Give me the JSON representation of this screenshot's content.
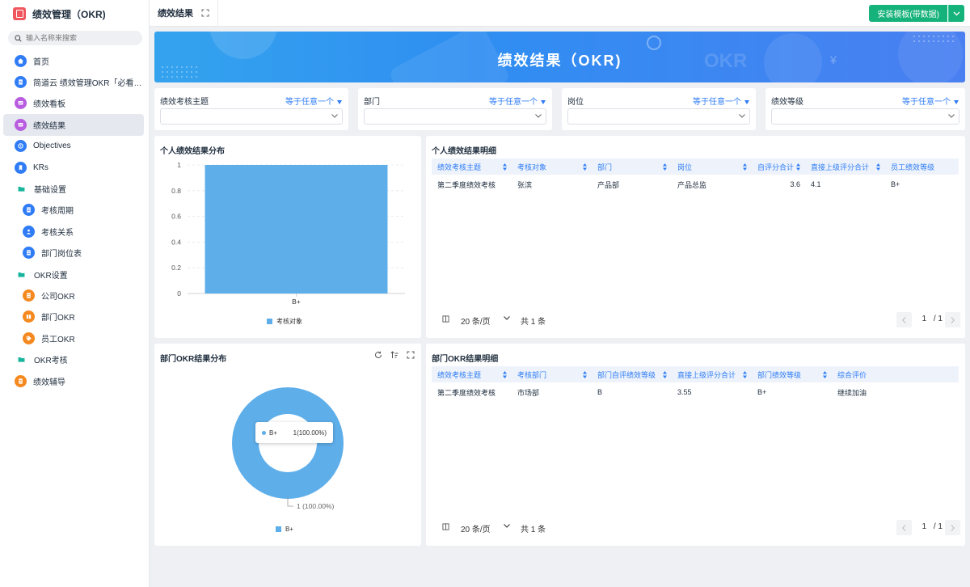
{
  "app": {
    "title": "绩效管理（OKR)"
  },
  "search": {
    "placeholder": "输入名称来搜索"
  },
  "sidebar": {
    "items": [
      {
        "label": "首页"
      },
      {
        "label": "简道云 绩效管理OKR「必看说..."
      },
      {
        "label": "绩效看板"
      },
      {
        "label": "绩效结果"
      },
      {
        "label": "Objectives"
      },
      {
        "label": "KRs"
      },
      {
        "label": "基础设置"
      },
      {
        "label": "考核周期"
      },
      {
        "label": "考核关系"
      },
      {
        "label": "部门岗位表"
      },
      {
        "label": "OKR设置"
      },
      {
        "label": "公司OKR"
      },
      {
        "label": "部门OKR"
      },
      {
        "label": "员工OKR"
      },
      {
        "label": "OKR考核"
      },
      {
        "label": "绩效辅导"
      }
    ]
  },
  "topbar": {
    "tab": "绩效结果",
    "install_label": "安装模板(带数据)"
  },
  "banner": {
    "title": "绩效结果（OKR)"
  },
  "filters": [
    {
      "label": "绩效考核主题",
      "mode": "等于任意一个"
    },
    {
      "label": "部门",
      "mode": "等于任意一个"
    },
    {
      "label": "岗位",
      "mode": "等于任意一个"
    },
    {
      "label": "绩效等级",
      "mode": "等于任意一个"
    }
  ],
  "personal_chart": {
    "title": "个人绩效结果分布"
  },
  "personal_table": {
    "title": "个人绩效结果明细",
    "columns": [
      "绩效考核主题",
      "考核对象",
      "部门",
      "岗位",
      "自评分合计",
      "直接上级评分合计",
      "员工绩效等级"
    ],
    "rows": [
      [
        "第二季度绩效考核",
        "张滨",
        "产品部",
        "产品总监",
        "3.6",
        "4.1",
        "B+"
      ]
    ],
    "pager": {
      "size": "20 条/页",
      "total": "共 1 条",
      "page": "1",
      "pages": "/ 1"
    }
  },
  "dept_chart": {
    "title": "部门OKR结果分布"
  },
  "dept_table": {
    "title": "部门OKR结果明细",
    "columns": [
      "绩效考核主题",
      "考核部门",
      "部门自评绩效等级",
      "直接上级评分合计",
      "部门绩效等级",
      "综合评价"
    ],
    "rows": [
      [
        "第二季度绩效考核",
        "市场部",
        "B",
        "3.55",
        "B+",
        "继续加油"
      ]
    ],
    "pager": {
      "size": "20 条/页",
      "total": "共 1 条",
      "page": "1",
      "pages": "/ 1"
    }
  },
  "chart_data": [
    {
      "type": "bar",
      "categories": [
        "B+"
      ],
      "series": [
        {
          "name": "考核对象",
          "values": [
            1
          ]
        }
      ],
      "ylim": [
        0,
        1
      ],
      "yticks": [
        "1",
        "0.8",
        "0.6",
        "0.4",
        "0.2",
        "0"
      ],
      "color": "#5eaeea"
    },
    {
      "type": "pie",
      "donut": true,
      "slices": [
        {
          "label": "B+",
          "value": 1,
          "percent": "100.00%"
        }
      ],
      "tooltip": {
        "label": "B+",
        "value": "1(100.00%)"
      },
      "data_label": "1 (100.00%)",
      "legend": [
        "B+"
      ],
      "color": "#5eaeea"
    }
  ],
  "colors": {
    "accent": "#2f7cf6",
    "primary_button": "#16b27b",
    "chart": "#5eaeea"
  }
}
